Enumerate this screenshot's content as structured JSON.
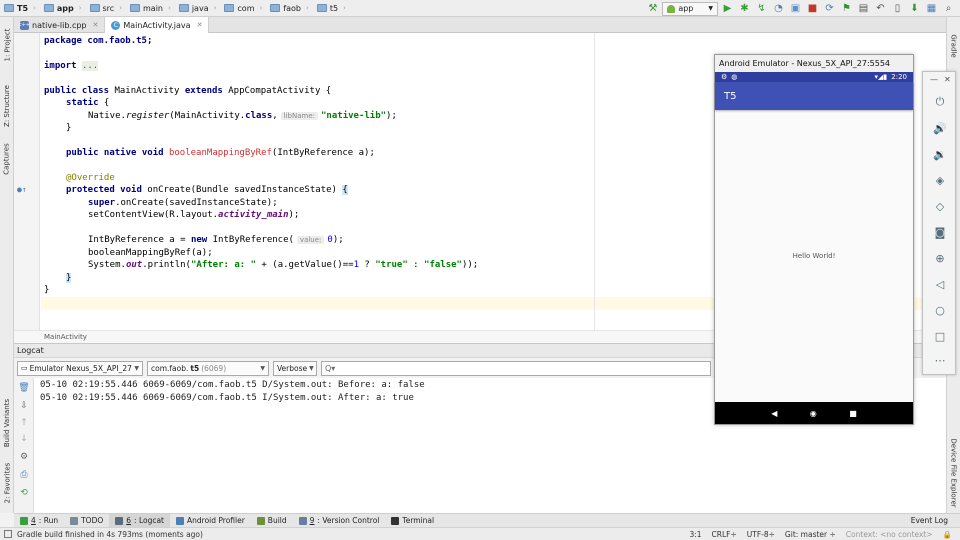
{
  "breadcrumbs": [
    {
      "label": "T5",
      "bold": true
    },
    {
      "label": "app",
      "bold": true
    },
    {
      "label": "src",
      "bold": false
    },
    {
      "label": "main",
      "bold": false
    },
    {
      "label": "java",
      "bold": false
    },
    {
      "label": "com",
      "bold": false
    },
    {
      "label": "faob",
      "bold": false
    },
    {
      "label": "t5",
      "bold": false
    }
  ],
  "toolbar": {
    "run_config": "app",
    "icons": [
      "build-hammer-icon",
      "run-icon",
      "debug-icon",
      "attach-debugger-icon",
      "profiler-icon",
      "coverage-icon",
      "stop-icon",
      "sync-icon",
      "avd-manager-icon",
      "sdk-manager-icon",
      "search-everywhere-icon"
    ]
  },
  "tabs": [
    {
      "label": "native-lib.cpp",
      "active": false,
      "icon": "cpp-file-icon"
    },
    {
      "label": "MainActivity.java",
      "active": true,
      "icon": "java-class-icon"
    }
  ],
  "left_tools": [
    "1: Project",
    "Z: Structure",
    "Captures",
    "Build Variants",
    "2: Favorites"
  ],
  "right_tools": [
    "Gradle",
    "Device File Explorer"
  ],
  "editor": {
    "lines": {
      "l1": "package com.faob.t5;",
      "l2_kw": "import",
      "l2_fold": "...",
      "l3_kw": "public class",
      "l3_name": " MainActivity ",
      "l3_kw2": "extends",
      "l3_rest": " AppCompatActivity {",
      "l4_kw": "static",
      "l4_rest": " {",
      "l5_a": "Native.",
      "l5_method": "register",
      "l5_b": "(MainActivity.",
      "l5_kw": "class",
      "l5_c": ",",
      "l5_hint": "libName:",
      "l5_str": "\"native-lib\"",
      "l5_d": ");",
      "l6": "}",
      "l7_kw": "public native void",
      "l7_method": "booleanMappingByRef",
      "l7_rest": "(IntByReference a);",
      "l8_ann": "@Override",
      "l9_kw": "protected void",
      "l9_rest": " onCreate(Bundle savedInstanceState) ",
      "l9_brace": "{",
      "l10_kw": "super",
      "l10_rest": ".onCreate(savedInstanceState);",
      "l11_a": "setContentView(R.layout.",
      "l11_field": "activity_main",
      "l11_b": ");",
      "l12_a": "IntByReference a = ",
      "l12_kw": "new",
      "l12_b": " IntByReference(",
      "l12_hint": "value:",
      "l12_num": "0",
      "l12_c": ");",
      "l13": "booleanMappingByRef(a);",
      "l14_a": "System.",
      "l14_field": "out",
      "l14_b": ".println(",
      "l14_str1": "\"After: a: \"",
      "l14_c": " + (a.getValue()==",
      "l14_num": "1",
      "l14_d": " ? ",
      "l14_str2": "\"true\"",
      "l14_e": " : ",
      "l14_str3": "\"false\"",
      "l14_f": "));",
      "l15_brace": "}",
      "l16": "}"
    },
    "footer_breadcrumb": "MainActivity"
  },
  "logcat": {
    "title": "Logcat",
    "device": "Emulator Nexus_5X_API_27",
    "process_prefix": "com.faob.",
    "process_bold": "t5",
    "process_pid": "(6069)",
    "level": "Verbose",
    "search_placeholder": "Q▾",
    "lines": [
      "05-10 02:19:55.446 6069-6069/com.faob.t5 D/System.out: Before: a: false",
      "05-10 02:19:55.446 6069-6069/com.faob.t5 I/System.out: After: a: true"
    ]
  },
  "bottom_tools": [
    {
      "key": "4",
      "label": ": Run",
      "active": false,
      "color": "#3a9e3a"
    },
    {
      "key": "",
      "label": "TODO",
      "active": false,
      "color": "#7a8a99"
    },
    {
      "key": "6",
      "label": ": Logcat",
      "active": true,
      "color": "#5a6b7c"
    },
    {
      "key": "",
      "label": "Android Profiler",
      "active": false,
      "color": "#4a7fb8"
    },
    {
      "key": "",
      "label": "Build",
      "active": false,
      "color": "#6f8f3f"
    },
    {
      "key": "9",
      "label": ": Version Control",
      "active": false,
      "color": "#6a7fa0"
    },
    {
      "key": "",
      "label": "Terminal",
      "active": false,
      "color": "#333333"
    }
  ],
  "event_log": "Event Log",
  "status": {
    "message": "Gradle build finished in 4s 793ms (moments ago)",
    "position": "3:1",
    "line_sep": "CRLF÷",
    "encoding": "UTF-8÷",
    "git": "Git: master ÷",
    "context": "Context: <no context>"
  },
  "emulator": {
    "window_title": "Android Emulator - Nexus_5X_API_27:5554",
    "time": "2:20",
    "app_title": "T5",
    "hello": "Hello World!",
    "colors": {
      "app_bar": "#3f51b5",
      "status_bar": "#303f9f"
    }
  }
}
